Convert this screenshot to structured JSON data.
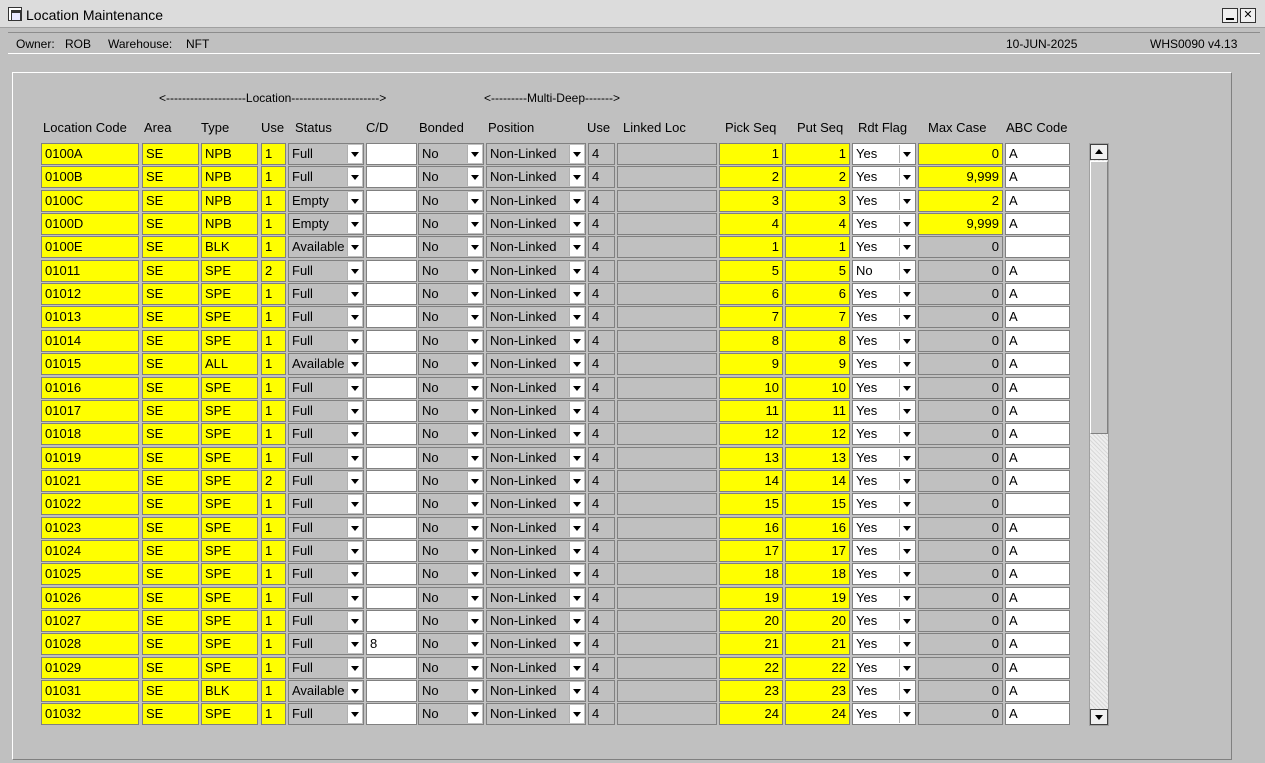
{
  "window": {
    "title": "Location Maintenance"
  },
  "info": {
    "owner_label": "Owner:",
    "owner_value": "ROB",
    "warehouse_label": "Warehouse:",
    "warehouse_value": "NFT",
    "date": "10-JUN-2025",
    "program": "WHS0090  v4.13"
  },
  "groups": {
    "location": "<--------------------Location---------------------->",
    "multi_deep": "<---------Multi-Deep------->"
  },
  "headers": {
    "location_code": "Location Code",
    "area": "Area",
    "type": "Type",
    "use": "Use",
    "status": "Status",
    "cd": "C/D",
    "bonded": "Bonded",
    "position": "Position",
    "md_use": "Use",
    "linked_loc": "Linked Loc",
    "pick_seq": "Pick Seq",
    "put_seq": "Put Seq",
    "rdt_flag": "Rdt Flag",
    "max_case": "Max Case",
    "abc_code": "ABC Code"
  },
  "rows": [
    {
      "code": "0100A",
      "area": "SE",
      "type": "NPB",
      "use": "1",
      "status": "Full",
      "cd": "",
      "bonded": "No",
      "position": "Non-Linked",
      "md_use": "4",
      "linked": "",
      "pick": "1",
      "put": "1",
      "rdt": "Yes",
      "max": "0",
      "abc": "A",
      "max_yellow": true
    },
    {
      "code": "0100B",
      "area": "SE",
      "type": "NPB",
      "use": "1",
      "status": "Full",
      "cd": "",
      "bonded": "No",
      "position": "Non-Linked",
      "md_use": "4",
      "linked": "",
      "pick": "2",
      "put": "2",
      "rdt": "Yes",
      "max": "9,999",
      "abc": "A",
      "max_yellow": true
    },
    {
      "code": "0100C",
      "area": "SE",
      "type": "NPB",
      "use": "1",
      "status": "Empty",
      "cd": "",
      "bonded": "No",
      "position": "Non-Linked",
      "md_use": "4",
      "linked": "",
      "pick": "3",
      "put": "3",
      "rdt": "Yes",
      "max": "2",
      "abc": "A",
      "max_yellow": true
    },
    {
      "code": "0100D",
      "area": "SE",
      "type": "NPB",
      "use": "1",
      "status": "Empty",
      "cd": "",
      "bonded": "No",
      "position": "Non-Linked",
      "md_use": "4",
      "linked": "",
      "pick": "4",
      "put": "4",
      "rdt": "Yes",
      "max": "9,999",
      "abc": "A",
      "max_yellow": true
    },
    {
      "code": "0100E",
      "area": "SE",
      "type": "BLK",
      "use": "1",
      "status": "Available",
      "cd": "",
      "bonded": "No",
      "position": "Non-Linked",
      "md_use": "4",
      "linked": "",
      "pick": "1",
      "put": "1",
      "rdt": "Yes",
      "max": "0",
      "abc": "",
      "max_yellow": false
    },
    {
      "code": "01011",
      "area": "SE",
      "type": "SPE",
      "use": "2",
      "status": "Full",
      "cd": "",
      "bonded": "No",
      "position": "Non-Linked",
      "md_use": "4",
      "linked": "",
      "pick": "5",
      "put": "5",
      "rdt": "No",
      "max": "0",
      "abc": "A",
      "max_yellow": false
    },
    {
      "code": "01012",
      "area": "SE",
      "type": "SPE",
      "use": "1",
      "status": "Full",
      "cd": "",
      "bonded": "No",
      "position": "Non-Linked",
      "md_use": "4",
      "linked": "",
      "pick": "6",
      "put": "6",
      "rdt": "Yes",
      "max": "0",
      "abc": "A",
      "max_yellow": false
    },
    {
      "code": "01013",
      "area": "SE",
      "type": "SPE",
      "use": "1",
      "status": "Full",
      "cd": "",
      "bonded": "No",
      "position": "Non-Linked",
      "md_use": "4",
      "linked": "",
      "pick": "7",
      "put": "7",
      "rdt": "Yes",
      "max": "0",
      "abc": "A",
      "max_yellow": false
    },
    {
      "code": "01014",
      "area": "SE",
      "type": "SPE",
      "use": "1",
      "status": "Full",
      "cd": "",
      "bonded": "No",
      "position": "Non-Linked",
      "md_use": "4",
      "linked": "",
      "pick": "8",
      "put": "8",
      "rdt": "Yes",
      "max": "0",
      "abc": "A",
      "max_yellow": false
    },
    {
      "code": "01015",
      "area": "SE",
      "type": "ALL",
      "use": "1",
      "status": "Available",
      "cd": "",
      "bonded": "No",
      "position": "Non-Linked",
      "md_use": "4",
      "linked": "",
      "pick": "9",
      "put": "9",
      "rdt": "Yes",
      "max": "0",
      "abc": "A",
      "max_yellow": false
    },
    {
      "code": "01016",
      "area": "SE",
      "type": "SPE",
      "use": "1",
      "status": "Full",
      "cd": "",
      "bonded": "No",
      "position": "Non-Linked",
      "md_use": "4",
      "linked": "",
      "pick": "10",
      "put": "10",
      "rdt": "Yes",
      "max": "0",
      "abc": "A",
      "max_yellow": false
    },
    {
      "code": "01017",
      "area": "SE",
      "type": "SPE",
      "use": "1",
      "status": "Full",
      "cd": "",
      "bonded": "No",
      "position": "Non-Linked",
      "md_use": "4",
      "linked": "",
      "pick": "11",
      "put": "11",
      "rdt": "Yes",
      "max": "0",
      "abc": "A",
      "max_yellow": false
    },
    {
      "code": "01018",
      "area": "SE",
      "type": "SPE",
      "use": "1",
      "status": "Full",
      "cd": "",
      "bonded": "No",
      "position": "Non-Linked",
      "md_use": "4",
      "linked": "",
      "pick": "12",
      "put": "12",
      "rdt": "Yes",
      "max": "0",
      "abc": "A",
      "max_yellow": false
    },
    {
      "code": "01019",
      "area": "SE",
      "type": "SPE",
      "use": "1",
      "status": "Full",
      "cd": "",
      "bonded": "No",
      "position": "Non-Linked",
      "md_use": "4",
      "linked": "",
      "pick": "13",
      "put": "13",
      "rdt": "Yes",
      "max": "0",
      "abc": "A",
      "max_yellow": false
    },
    {
      "code": "01021",
      "area": "SE",
      "type": "SPE",
      "use": "2",
      "status": "Full",
      "cd": "",
      "bonded": "No",
      "position": "Non-Linked",
      "md_use": "4",
      "linked": "",
      "pick": "14",
      "put": "14",
      "rdt": "Yes",
      "max": "0",
      "abc": "A",
      "max_yellow": false
    },
    {
      "code": "01022",
      "area": "SE",
      "type": "SPE",
      "use": "1",
      "status": "Full",
      "cd": "",
      "bonded": "No",
      "position": "Non-Linked",
      "md_use": "4",
      "linked": "",
      "pick": "15",
      "put": "15",
      "rdt": "Yes",
      "max": "0",
      "abc": "",
      "max_yellow": false
    },
    {
      "code": "01023",
      "area": "SE",
      "type": "SPE",
      "use": "1",
      "status": "Full",
      "cd": "",
      "bonded": "No",
      "position": "Non-Linked",
      "md_use": "4",
      "linked": "",
      "pick": "16",
      "put": "16",
      "rdt": "Yes",
      "max": "0",
      "abc": "A",
      "max_yellow": false
    },
    {
      "code": "01024",
      "area": "SE",
      "type": "SPE",
      "use": "1",
      "status": "Full",
      "cd": "",
      "bonded": "No",
      "position": "Non-Linked",
      "md_use": "4",
      "linked": "",
      "pick": "17",
      "put": "17",
      "rdt": "Yes",
      "max": "0",
      "abc": "A",
      "max_yellow": false
    },
    {
      "code": "01025",
      "area": "SE",
      "type": "SPE",
      "use": "1",
      "status": "Full",
      "cd": "",
      "bonded": "No",
      "position": "Non-Linked",
      "md_use": "4",
      "linked": "",
      "pick": "18",
      "put": "18",
      "rdt": "Yes",
      "max": "0",
      "abc": "A",
      "max_yellow": false
    },
    {
      "code": "01026",
      "area": "SE",
      "type": "SPE",
      "use": "1",
      "status": "Full",
      "cd": "",
      "bonded": "No",
      "position": "Non-Linked",
      "md_use": "4",
      "linked": "",
      "pick": "19",
      "put": "19",
      "rdt": "Yes",
      "max": "0",
      "abc": "A",
      "max_yellow": false
    },
    {
      "code": "01027",
      "area": "SE",
      "type": "SPE",
      "use": "1",
      "status": "Full",
      "cd": "",
      "bonded": "No",
      "position": "Non-Linked",
      "md_use": "4",
      "linked": "",
      "pick": "20",
      "put": "20",
      "rdt": "Yes",
      "max": "0",
      "abc": "A",
      "max_yellow": false
    },
    {
      "code": "01028",
      "area": "SE",
      "type": "SPE",
      "use": "1",
      "status": "Full",
      "cd": "8",
      "bonded": "No",
      "position": "Non-Linked",
      "md_use": "4",
      "linked": "",
      "pick": "21",
      "put": "21",
      "rdt": "Yes",
      "max": "0",
      "abc": "A",
      "max_yellow": false
    },
    {
      "code": "01029",
      "area": "SE",
      "type": "SPE",
      "use": "1",
      "status": "Full",
      "cd": "",
      "bonded": "No",
      "position": "Non-Linked",
      "md_use": "4",
      "linked": "",
      "pick": "22",
      "put": "22",
      "rdt": "Yes",
      "max": "0",
      "abc": "A",
      "max_yellow": false
    },
    {
      "code": "01031",
      "area": "SE",
      "type": "BLK",
      "use": "1",
      "status": "Available",
      "cd": "",
      "bonded": "No",
      "position": "Non-Linked",
      "md_use": "4",
      "linked": "",
      "pick": "23",
      "put": "23",
      "rdt": "Yes",
      "max": "0",
      "abc": "A",
      "max_yellow": false
    },
    {
      "code": "01032",
      "area": "SE",
      "type": "SPE",
      "use": "1",
      "status": "Full",
      "cd": "",
      "bonded": "No",
      "position": "Non-Linked",
      "md_use": "4",
      "linked": "",
      "pick": "24",
      "put": "24",
      "rdt": "Yes",
      "max": "0",
      "abc": "A",
      "max_yellow": false
    }
  ],
  "colors": {
    "required_field": "#ffff00",
    "optional_field": "#ffffff",
    "readonly_field": "#c0c0c0",
    "background": "#c0c0c0"
  }
}
